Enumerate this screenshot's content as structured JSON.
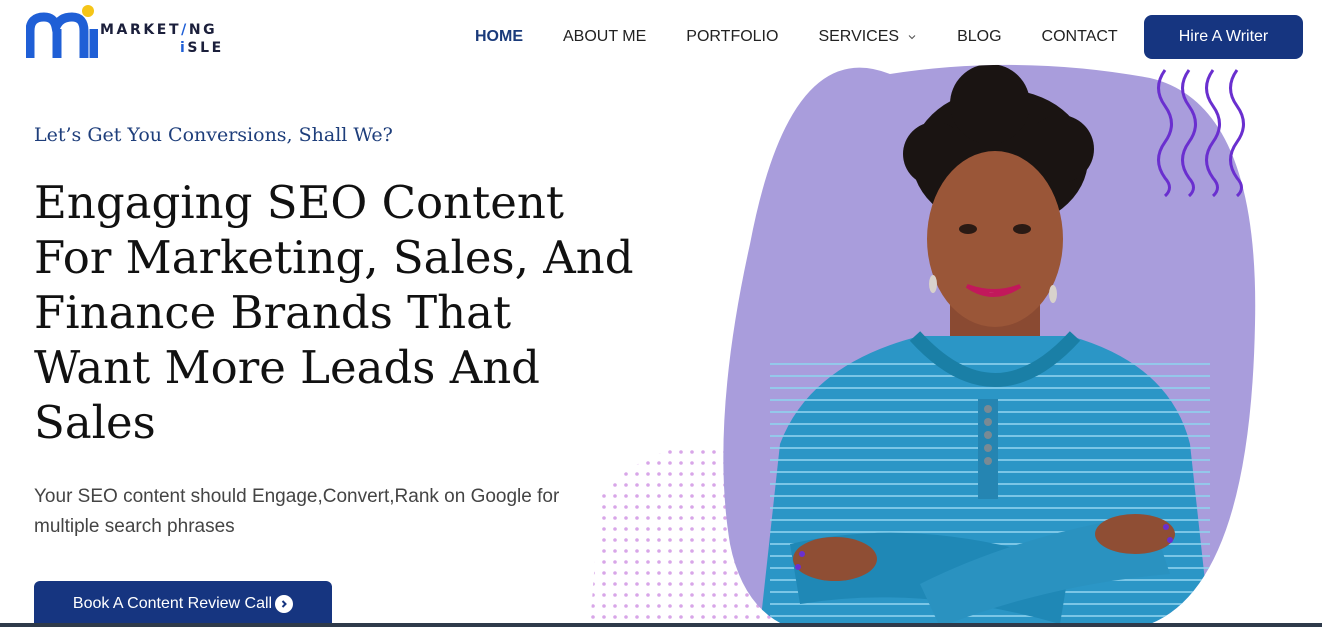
{
  "brand": {
    "logo_line1": "MARKET",
    "logo_line1_end": "NG",
    "logo_line2": "SLE",
    "primary_color": "#163580",
    "accent_color": "#6a2fcf"
  },
  "nav": {
    "items": [
      {
        "label": "HOME",
        "active": true
      },
      {
        "label": "ABOUT ME",
        "active": false
      },
      {
        "label": "PORTFOLIO",
        "active": false
      },
      {
        "label": "SERVICES",
        "active": false,
        "has_dropdown": true
      },
      {
        "label": "BLOG",
        "active": false
      },
      {
        "label": "CONTACT",
        "active": false
      }
    ],
    "cta_label": "Hire A Writer"
  },
  "hero": {
    "tagline": "Let’s Get You Conversions, Shall We?",
    "headline_lines": [
      "Engaging SEO Content",
      "For Marketing, Sales, And",
      "Finance Brands That",
      "Want More Leads And",
      "Sales"
    ],
    "subtext": "Your SEO content should Engage,Convert,Rank on Google for multiple search phrases",
    "cta_label": "Book A Content Review Call",
    "cta_icon": "chevron-right-circle-icon"
  }
}
